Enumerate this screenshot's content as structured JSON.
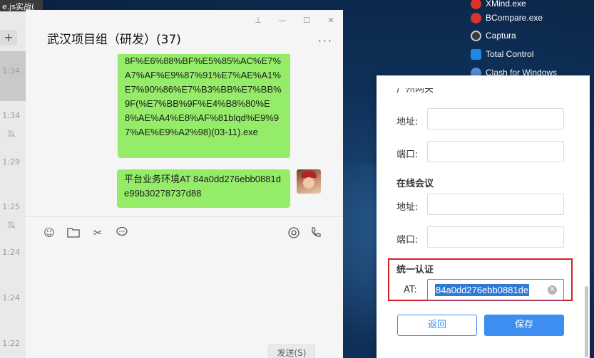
{
  "desktop": {
    "taskbar_items": [
      {
        "label": "XMind.exe",
        "icon": "xmind-icon",
        "color": "#e0302a"
      },
      {
        "label": "BCompare.exe",
        "icon": "bcompare-icon",
        "color": "#d9332b"
      },
      {
        "label": "Captura",
        "icon": "captura-icon",
        "color": "#3b3b3b"
      },
      {
        "label": "Total Control",
        "icon": "total-control-icon",
        "color": "#1e88e5"
      },
      {
        "label": "Clash for Windows",
        "icon": "clash-icon",
        "color": "#5b8bd6"
      }
    ]
  },
  "chat_list": {
    "top_fragment": "e.js实战(",
    "new_button": "+",
    "times": [
      "1:34",
      "1:34",
      "1:29",
      "1:25",
      "1:24",
      "1:24",
      "1:22"
    ]
  },
  "chat": {
    "title": "武汉项目组（研发）(37)",
    "more": "···",
    "messages": [
      {
        "text": "8F%E6%88%BF%E5%85%AC%E7%A7%AF%E9%87%91%E7%AE%A1%E7%90%86%E7%B3%BB%E7%BB%9F(%E7%BB%9F%E4%B8%80%E8%AE%A4%E8%AF%81blqd%E9%97%AE%E9%A2%98)(03-11).exe"
      },
      {
        "text": "平台业务环境AT 84a0dd276ebb0881de99b30278737d88"
      }
    ],
    "send_label": "发送(S)"
  },
  "dialog": {
    "fragment": "广州网关",
    "address_label": "地址:",
    "port_label": "端口:",
    "online_meeting": "在线会议",
    "unified_auth": "统一认证",
    "at_label": "AT:",
    "at_value": "84a0dd276ebb0881de",
    "back_label": "返回",
    "save_label": "保存"
  }
}
